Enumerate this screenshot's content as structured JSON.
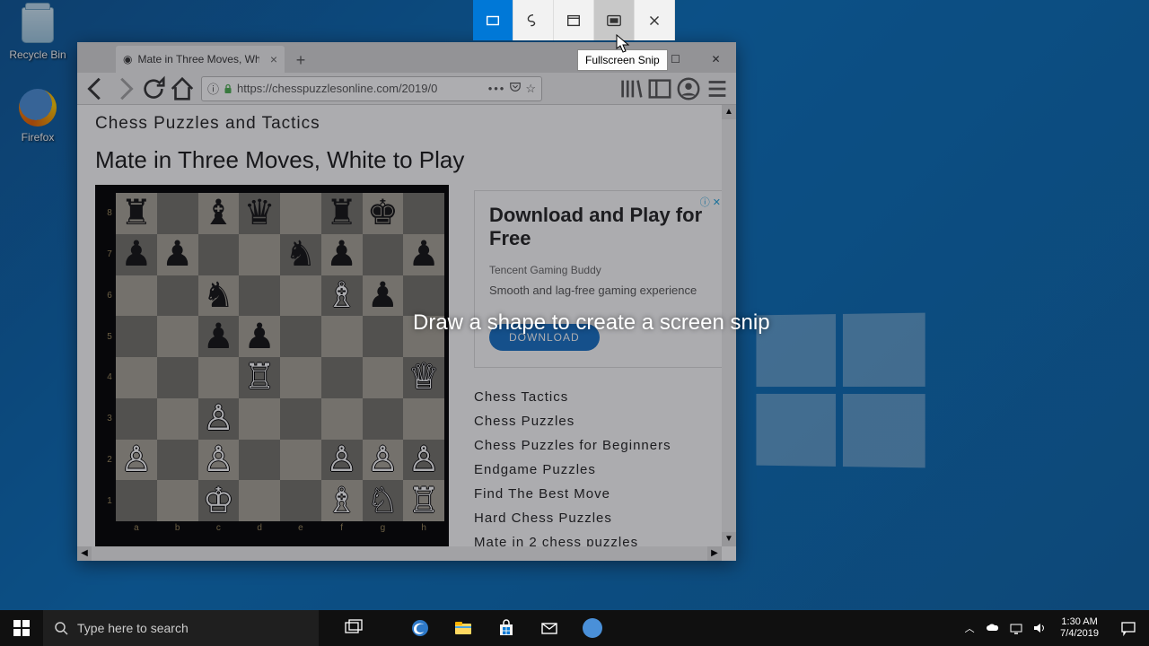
{
  "desktop": {
    "icons": [
      {
        "name": "recycle-bin",
        "label": "Recycle Bin"
      },
      {
        "name": "firefox",
        "label": "Firefox"
      }
    ]
  },
  "snip": {
    "tooltip": "Fullscreen Snip",
    "hint": "Draw a shape to create a screen snip"
  },
  "taskbar": {
    "search_placeholder": "Type here to search",
    "clock_time": "1:30 AM",
    "clock_date": "7/4/2019"
  },
  "firefox": {
    "tab_title": "Mate in Three Moves, White to",
    "url": "https://chesspuzzlesonline.com/2019/0"
  },
  "page": {
    "site_title": "Chess Puzzles and Tactics",
    "page_title": "Mate in Three Moves, White to Play",
    "ad": {
      "title": "Download and Play for Free",
      "subtitle": "Tencent Gaming Buddy",
      "desc": "Smooth and lag-free gaming experience",
      "button": "DOWNLOAD"
    },
    "categories": [
      "Chess Tactics",
      "Chess Puzzles",
      "Chess Puzzles for Beginners",
      "Endgame Puzzles",
      "Find The Best Move",
      "Hard Chess Puzzles",
      "Mate in 2 chess puzzles"
    ]
  },
  "chart_data": {
    "type": "table",
    "description": "Chess position, white to play, mate in 3",
    "ranks": [
      "8",
      "7",
      "6",
      "5",
      "4",
      "3",
      "2",
      "1"
    ],
    "files": [
      "a",
      "b",
      "c",
      "d",
      "e",
      "f",
      "g",
      "h"
    ],
    "board": [
      [
        "r",
        ".",
        "b",
        "q",
        ".",
        "r",
        "k",
        "."
      ],
      [
        "p",
        "p",
        ".",
        ".",
        "n",
        "p",
        ".",
        "p"
      ],
      [
        ".",
        ".",
        "n",
        ".",
        ".",
        "B",
        "p",
        "."
      ],
      [
        ".",
        ".",
        "p",
        "p",
        ".",
        ".",
        ".",
        "."
      ],
      [
        ".",
        ".",
        ".",
        "R",
        ".",
        ".",
        ".",
        "Q"
      ],
      [
        ".",
        ".",
        "P",
        ".",
        ".",
        ".",
        ".",
        "."
      ],
      [
        "P",
        ".",
        "P",
        ".",
        ".",
        "P",
        "P",
        "P"
      ],
      [
        ".",
        ".",
        "K",
        ".",
        ".",
        "B",
        "N",
        "R"
      ]
    ],
    "glyph": {
      "r": "♜",
      "n": "♞",
      "b": "♝",
      "q": "♛",
      "k": "♚",
      "p": "♟",
      "R": "♖",
      "N": "♘",
      "B": "♗",
      "Q": "♕",
      "K": "♔",
      "P": "♙"
    }
  }
}
